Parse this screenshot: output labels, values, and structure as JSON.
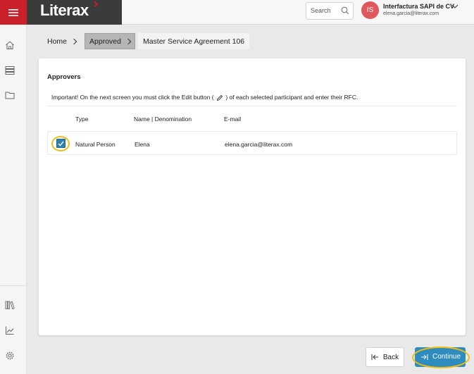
{
  "brand": {
    "name": "Literax"
  },
  "header": {
    "search_placeholder": "Search",
    "avatar_initials": "IS",
    "company": "Interfactura SAPI de CV",
    "email": "elena.garcia@literax.com"
  },
  "breadcrumb": {
    "home": "Home",
    "approved": "Approved",
    "current": "Master Service Agreement 106"
  },
  "panel": {
    "title": "Approvers",
    "notice_before": "Important! On the next screen you must click the Edit button (",
    "notice_after": ") of each selected participant and enter their RFC.",
    "columns": {
      "type": "Type",
      "name": "Name | Denomination",
      "email": "E-mail"
    },
    "rows": [
      {
        "checked": true,
        "type": "Natural Person",
        "name": "Elena",
        "email": "elena.garcia@literax.com"
      }
    ]
  },
  "footer": {
    "back_label": "Back",
    "continue_label": "Continue"
  },
  "colors": {
    "brand_red": "#c9202a",
    "primary_blue": "#2f8cbf",
    "highlight_ring": "#f1bd12"
  }
}
